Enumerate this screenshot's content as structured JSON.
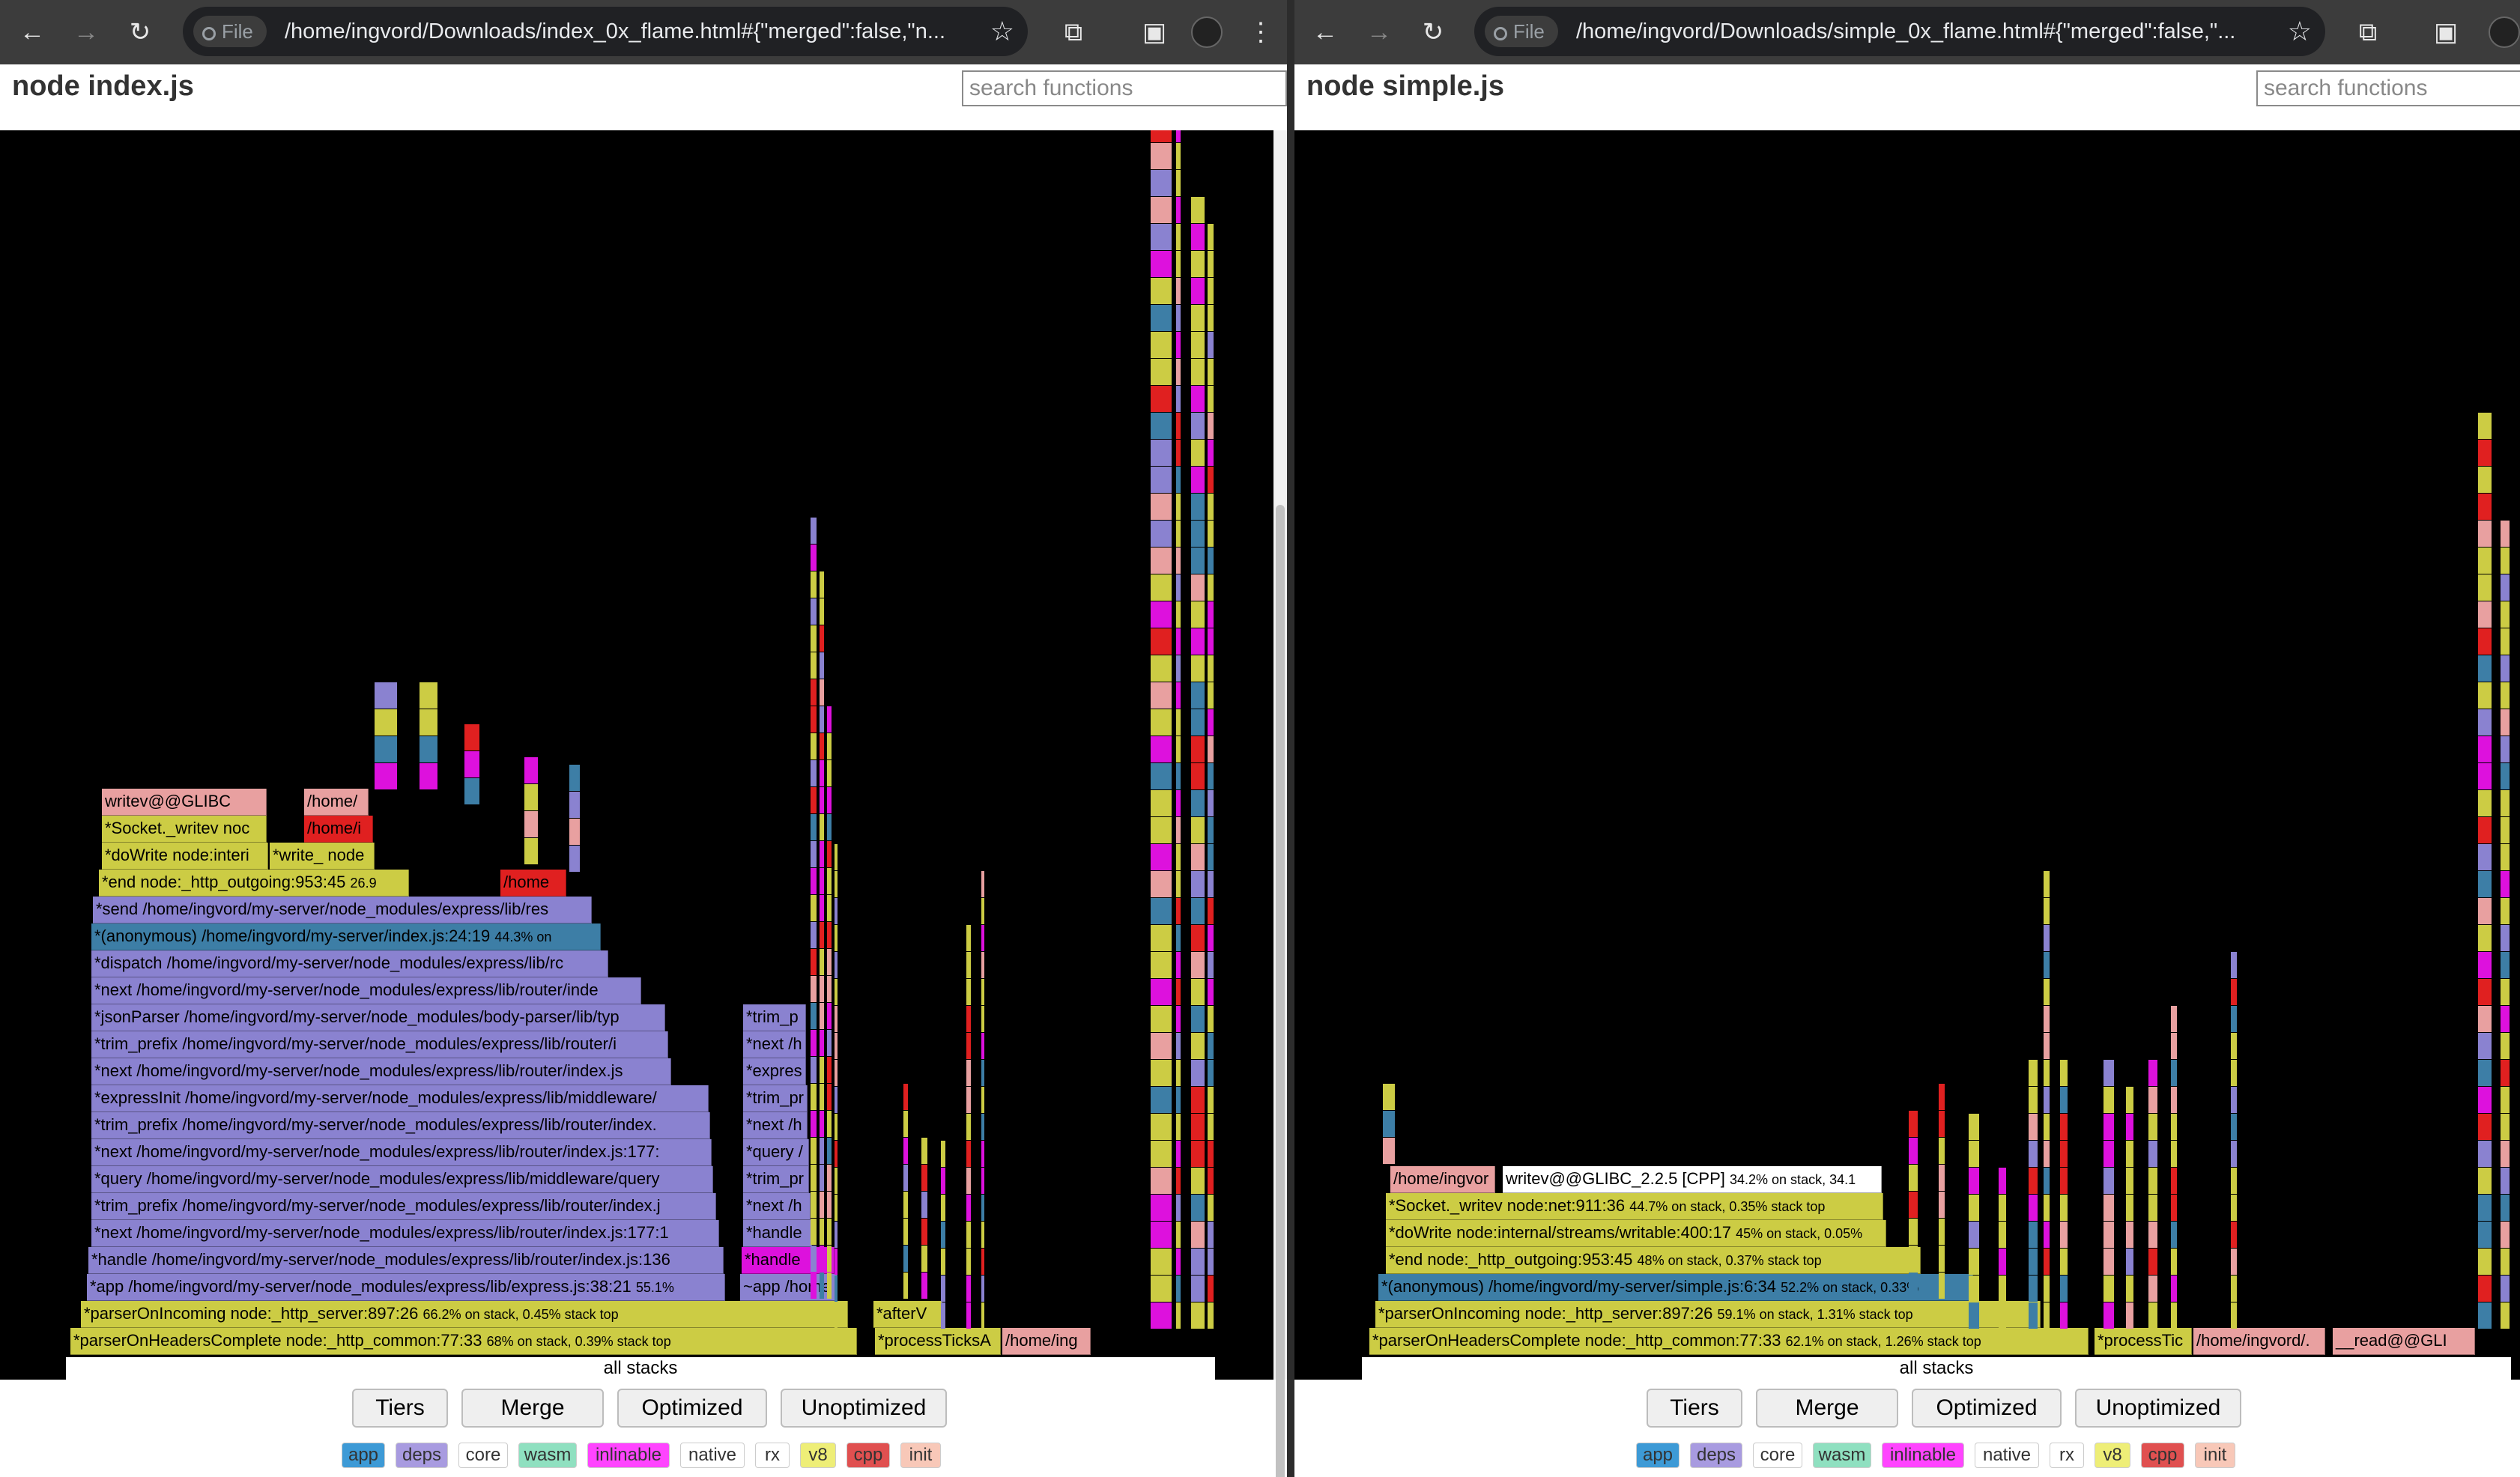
{
  "colors": {
    "yellow": "#cccc44",
    "purple": "#8a82d0",
    "teal": "#3d7ea6",
    "red": "#e02020",
    "pink": "#dd11dd",
    "salmon": "#e8a0a0"
  },
  "icons": {
    "back": "←",
    "forward": "→",
    "reload": "↻",
    "star": "☆",
    "extensions": "⧉",
    "sidepanel": "▣",
    "menu": "⋮"
  },
  "left": {
    "file_chip": "File",
    "url": "/home/ingvord/Downloads/index_0x_flame.html#{\"merged\":false,\"n...",
    "title": "node index.js",
    "search_placeholder": "search functions",
    "frames": [
      "writev@@GLIBC",
      "/home/",
      "*Socket._writev noc",
      "/home/i",
      "*doWrite node:interi",
      "*write_ node",
      "*end node:_http_outgoing:953:45",
      "26.9",
      "/home",
      "*send /home/ingvord/my-server/node_modules/express/lib/res",
      "*(anonymous) /home/ingvord/my-server/index.js:24:19",
      "44.3% on",
      "*dispatch /home/ingvord/my-server/node_modules/express/lib/rc",
      "*next /home/ingvord/my-server/node_modules/express/lib/router/inde",
      "*jsonParser /home/ingvord/my-server/node_modules/body-parser/lib/typ",
      "*trim_prefix /home/ingvord/my-server/node_modules/express/lib/router/i",
      "*next /home/ingvord/my-server/node_modules/express/lib/router/index.js",
      "*expressInit /home/ingvord/my-server/node_modules/express/lib/middleware/",
      "*trim_prefix /home/ingvord/my-server/node_modules/express/lib/router/index.",
      "*next /home/ingvord/my-server/node_modules/express/lib/router/index.js:177:",
      "*query /home/ingvord/my-server/node_modules/express/lib/middleware/query",
      "*trim_prefix /home/ingvord/my-server/node_modules/express/lib/router/index.j",
      "*next /home/ingvord/my-server/node_modules/express/lib/router/index.js:177:1",
      "*handle /home/ingvord/my-server/node_modules/express/lib/router/index.js:136",
      "*app /home/ingvord/my-server/node_modules/express/lib/express.js:38:21",
      "55.1%",
      "*parserOnIncoming node:_http_server:897:26",
      "66.2% on stack, 0.45% stack top",
      "*parserOnHeadersComplete node:_http_common:77:33",
      "68% on stack, 0.39% stack top",
      "*trim_p",
      "*next /h",
      "*expres",
      "*trim_pr",
      "*next /h",
      "*query /",
      "*trim_pr",
      "*next /h",
      "*handle",
      "*handle",
      "~app /home",
      "*afterV",
      "*processTicksA",
      "/home/ing"
    ],
    "all_stacks": "all stacks"
  },
  "right": {
    "file_chip": "File",
    "url": "/home/ingvord/Downloads/simple_0x_flame.html#{\"merged\":false,\"...",
    "title": "node simple.js",
    "search_placeholder": "search functions",
    "frames": [
      "/home/ingvor",
      "writev@@GLIBC_2.2.5 [CPP]",
      "34.2% on stack, 34.1",
      "*Socket._writev node:net:911:36",
      "44.7% on stack, 0.35% stack top",
      "*doWrite node:internal/streams/writable:400:17",
      "45% on stack, 0.05%",
      "*end node:_http_outgoing:953:45",
      "48% on stack, 0.37% stack top",
      "*(anonymous) /home/ingvord/my-server/simple.js:6:34",
      "52.2% on stack, 0.33%",
      "*parserOnIncoming node:_http_server:897:26",
      "59.1% on stack, 1.31% stack top",
      "*parserOnHeadersComplete node:_http_common:77:33",
      "62.1% on stack, 1.26% stack top",
      "*processTic",
      "/home/ingvord/.",
      "__read@@GLI"
    ],
    "all_stacks": "all stacks"
  },
  "toolbar": {
    "buttons": [
      "Tiers",
      "Merge",
      "Optimized",
      "Unoptimized"
    ]
  },
  "legend": {
    "items": [
      {
        "label": "app",
        "color": "#3d9ad6"
      },
      {
        "label": "deps",
        "color": "#a89be0"
      },
      {
        "label": "core",
        "color": "#ffffff"
      },
      {
        "label": "wasm",
        "color": "#8fe0c0"
      },
      {
        "label": "inlinable",
        "color": "#ff44ff"
      },
      {
        "label": "native",
        "color": "#ffffff"
      },
      {
        "label": "rx",
        "color": "#ffffff"
      },
      {
        "label": "v8",
        "color": "#eeee77"
      },
      {
        "label": "cpp",
        "color": "#e05050"
      },
      {
        "label": "init",
        "color": "#f8c8b8"
      }
    ]
  }
}
